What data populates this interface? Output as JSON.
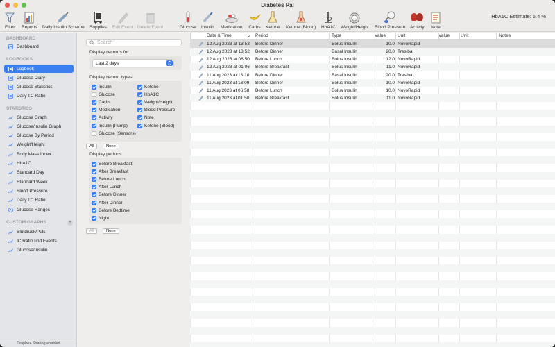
{
  "window": {
    "title": "Diabetes Pal"
  },
  "toolbar": {
    "filter": "Filter",
    "reports": "Reports",
    "daily_insulin_scheme": "Daily Insulin Scheme",
    "supplies": "Supplies",
    "edit_event": "Edit Event",
    "delete_event": "Delete Event",
    "glucose": "Glucose",
    "insulin": "Insulin",
    "medication": "Medication",
    "carbs": "Carbs",
    "ketone": "Ketone",
    "ketone_blood": "Ketone (Blood)",
    "hba1c": "HbA1C",
    "weight_height": "Weight/Height",
    "blood_pressure": "Blood Pressure",
    "activity": "Activity",
    "note": "Note",
    "hba1c_estimate": "HbA1C Estimate: 6.4 %"
  },
  "sidebar": {
    "sections": {
      "dashboard": "DASHBOARD",
      "logbooks": "LOGBOOKS",
      "statistics": "STATISTICS",
      "custom_graphs": "CUSTOM GRAPHS"
    },
    "dashboard_items": [
      "Dashboard"
    ],
    "logbook_items": [
      "Logbook",
      "Glucose Diary",
      "Glucose Statistics",
      "Daily I:C Ratio"
    ],
    "statistics_items": [
      "Glucose Graph",
      "Glucose/Insulin Graph",
      "Glucose By Period",
      "Weight/Height",
      "Body Mass Index",
      "HbA1C",
      "Standard Day",
      "Standard Week",
      "Blood Pressure",
      "Daily I:C Ratio",
      "Glucose Ranges"
    ],
    "custom_items": [
      "Blutdruck/Puls",
      "IC Ratio und Events",
      "Glucose/Insulin"
    ],
    "add_symbol": "+",
    "footer": "Dropbox Sharing enabled"
  },
  "filter": {
    "search_placeholder": "Search",
    "display_records_for": "Display records for",
    "records_for_value": "Last 2 days",
    "display_record_types": "Display record types",
    "types_left": [
      {
        "label": "Insulin",
        "checked": true
      },
      {
        "label": "Glucose",
        "checked": false
      },
      {
        "label": "Carbs",
        "checked": true
      },
      {
        "label": "Medication",
        "checked": true
      },
      {
        "label": "Activity",
        "checked": true
      },
      {
        "label": "Insulin (Pump)",
        "checked": true
      },
      {
        "label": "Glucose (Sensors)",
        "checked": false
      }
    ],
    "types_right": [
      {
        "label": "Ketone",
        "checked": true
      },
      {
        "label": "HbA1C",
        "checked": true
      },
      {
        "label": "Weight/Height",
        "checked": true
      },
      {
        "label": "Blood Pressure",
        "checked": true
      },
      {
        "label": "Note",
        "checked": true
      },
      {
        "label": "Ketone (Blood)",
        "checked": true
      }
    ],
    "all_label": "All",
    "none_label": "None",
    "display_periods": "Display periods",
    "periods": [
      {
        "label": "Before Breakfast",
        "checked": true
      },
      {
        "label": "After Breakfast",
        "checked": true
      },
      {
        "label": "Before Lunch",
        "checked": true
      },
      {
        "label": "After Lunch",
        "checked": true
      },
      {
        "label": "Before Dinner",
        "checked": true
      },
      {
        "label": "After Dinner",
        "checked": true
      },
      {
        "label": "Before Bedtime",
        "checked": true
      },
      {
        "label": "Night",
        "checked": true
      }
    ]
  },
  "table": {
    "headers": [
      "Date & Time",
      "Period",
      "Type",
      "Value",
      "Unit",
      "Value",
      "Unit",
      "Notes"
    ],
    "sort_indicator": "⌄",
    "rows": [
      {
        "date": "12 Aug 2023 at 13:53",
        "period": "Before Dinner",
        "type": "Bolus Insulin",
        "value": "10.0",
        "unit": "NovoRapid"
      },
      {
        "date": "12 Aug 2023 at 13:52",
        "period": "Before Dinner",
        "type": "Basal Insulin",
        "value": "20.0",
        "unit": "Tresiba"
      },
      {
        "date": "12 Aug 2023 at 06:50",
        "period": "Before Lunch",
        "type": "Bolus Insulin",
        "value": "12.0",
        "unit": "NovoRapid"
      },
      {
        "date": "12 Aug 2023 at 01:06",
        "period": "Before Breakfast",
        "type": "Bolus Insulin",
        "value": "11.0",
        "unit": "NovoRapid"
      },
      {
        "date": "11 Aug 2023 at 13:10",
        "period": "Before Dinner",
        "type": "Basal Insulin",
        "value": "20.0",
        "unit": "Tresiba"
      },
      {
        "date": "11 Aug 2023 at 13:09",
        "period": "Before Dinner",
        "type": "Bolus Insulin",
        "value": "10.0",
        "unit": "NovoRapid"
      },
      {
        "date": "11 Aug 2023 at 06:58",
        "period": "Before Lunch",
        "type": "Bolus Insulin",
        "value": "10.0",
        "unit": "NovoRapid"
      },
      {
        "date": "11 Aug 2023 at 01:50",
        "period": "Before Breakfast",
        "type": "Bolus Insulin",
        "value": "11.0",
        "unit": "NovoRapid"
      }
    ]
  },
  "colors": {
    "accent": "#3c7ff0",
    "selected_row": "#dcdcdc",
    "sidebar_bg": "#e3e5e8"
  }
}
